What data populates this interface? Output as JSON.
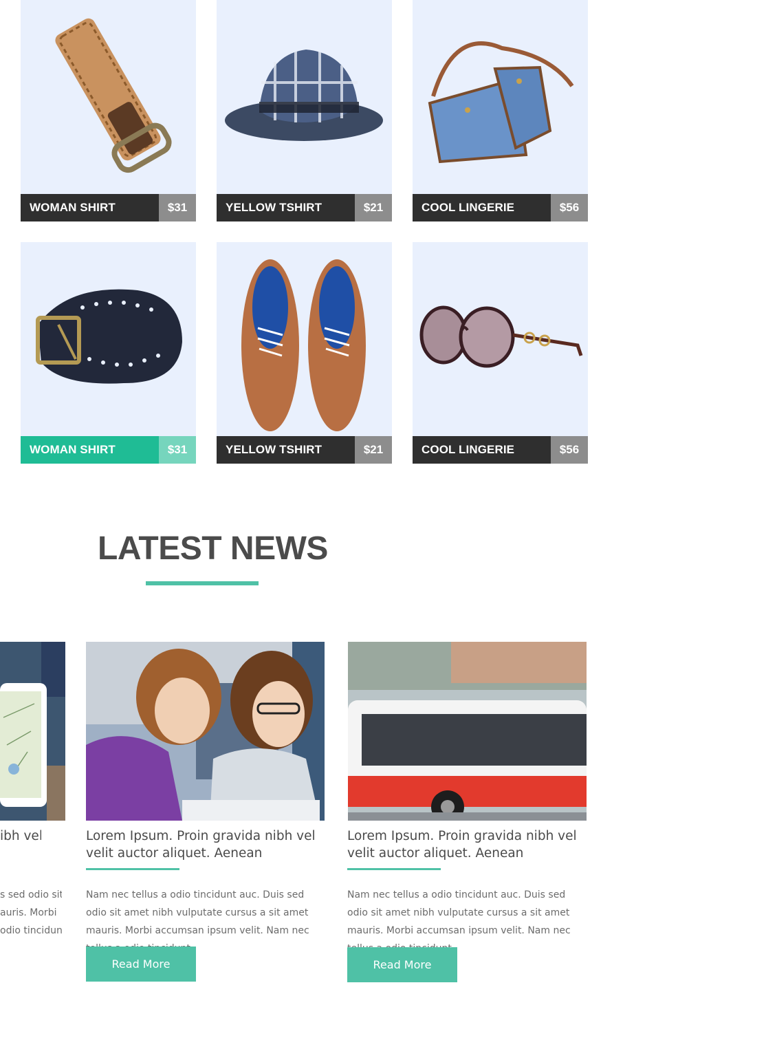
{
  "products": [
    {
      "name": "WOMAN SHIRT",
      "price": "$31",
      "item": "braided-belt",
      "active": false
    },
    {
      "name": "YELLOW TSHIRT",
      "price": "$21",
      "item": "plaid-fedora",
      "active": false
    },
    {
      "name": "COOL LINGERIE",
      "price": "$56",
      "item": "denim-bag",
      "active": false
    },
    {
      "name": "WOMAN SHIRT",
      "price": "$31",
      "item": "perforated-belt",
      "active": true
    },
    {
      "name": "YELLOW TSHIRT",
      "price": "$21",
      "item": "leather-shoes",
      "active": false
    },
    {
      "name": "COOL LINGERIE",
      "price": "$56",
      "item": "sunglasses",
      "active": false
    }
  ],
  "latest_news": {
    "title": "LATEST NEWS",
    "accent": "#4fc1a6"
  },
  "news": [
    {
      "heading": "Lorem Ipsum. Proin gravida nibh vel velit auctor aliquet. Aenean",
      "heading_partial": "ibh vel",
      "text_partial_1": "s sed odio sit",
      "text_partial_2": "auris. Morbi",
      "text_partial_3": "odio tincidunt"
    },
    {
      "heading": "Lorem Ipsum. Proin gravida nibh vel velit auctor aliquet. Aenean",
      "text": "Nam nec tellus a odio tincidunt auc. Duis sed odio sit amet nibh vulputate cursus a sit amet mauris. Morbi accumsan ipsum velit. Nam nec tellus a odio tincidunt",
      "button": "Read More"
    },
    {
      "heading": "Lorem Ipsum. Proin gravida nibh vel velit auctor aliquet. Aenean",
      "text": "Nam nec tellus a odio tincidunt auc. Duis sed odio sit amet nibh vulputate cursus a sit amet mauris. Morbi accumsan ipsum velit. Nam nec tellus a odio tincidunt",
      "button": "Read More"
    }
  ],
  "colors": {
    "card_bg": "#e9f0fd",
    "bar_dark": "#2f2f2f",
    "bar_active": "#1fbc95",
    "price_gray": "#8d8d8d",
    "price_active": "#76d5bd"
  }
}
